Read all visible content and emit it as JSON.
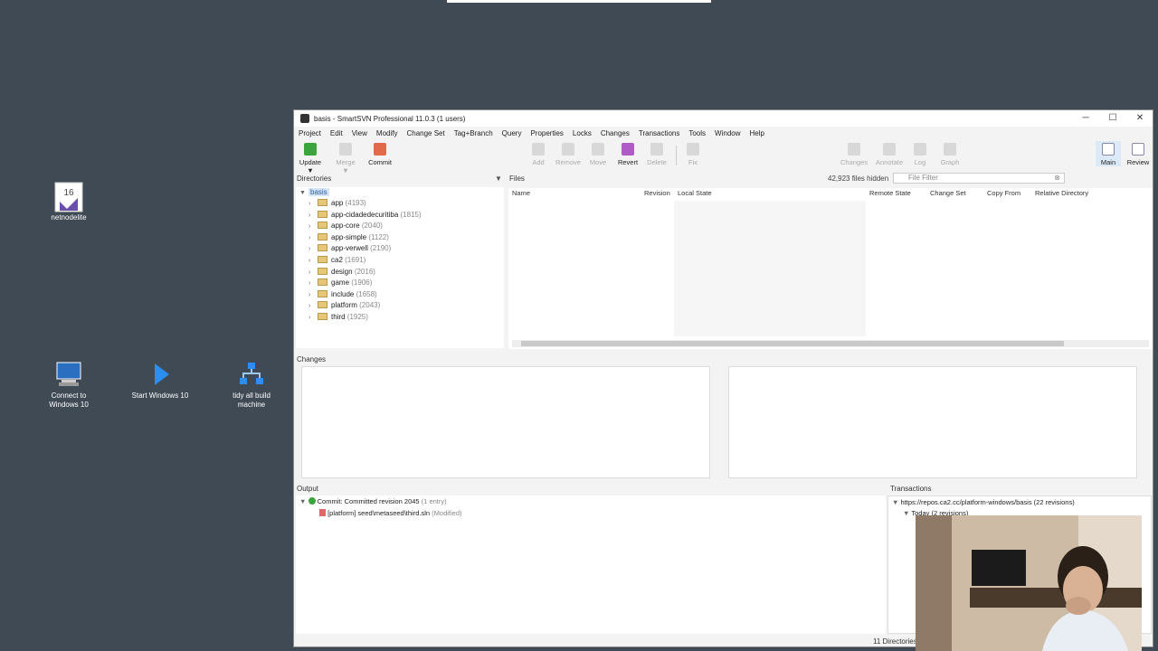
{
  "desktop": {
    "icons": [
      {
        "label": "netnodelite",
        "icon": "visual-studio-icon"
      },
      {
        "label": "Connect to Windows 10",
        "icon": "remote-desktop-icon"
      },
      {
        "label": "Start Windows 10",
        "icon": "play-icon"
      },
      {
        "label": "tidy all build machine",
        "icon": "network-icon"
      }
    ]
  },
  "window": {
    "title": "basis - SmartSVN Professional 11.0.3 (1 users)",
    "controls": {
      "minimize": "─",
      "maximize": "☐",
      "close": "✕"
    }
  },
  "menu": [
    "Project",
    "Edit",
    "View",
    "Modify",
    "Change Set",
    "Tag+Branch",
    "Query",
    "Properties",
    "Locks",
    "Changes",
    "Transactions",
    "Tools",
    "Window",
    "Help"
  ],
  "toolbar": {
    "update": "Update ▼",
    "merge": "Merge ▼",
    "commit": "Commit",
    "add": "Add",
    "remove": "Remove",
    "move": "Move",
    "revert": "Revert",
    "delete": "Delete",
    "fix": "Fix",
    "changes": "Changes",
    "annotate": "Annotate",
    "log": "Log",
    "graph": "Graph",
    "main": "Main",
    "review": "Review"
  },
  "directories": {
    "header": "Directories",
    "root": "basis",
    "items": [
      {
        "name": "app",
        "count": "(4193)"
      },
      {
        "name": "app-cidadedecuritiba",
        "count": "(1815)"
      },
      {
        "name": "app-core",
        "count": "(2040)"
      },
      {
        "name": "app-simple",
        "count": "(1122)"
      },
      {
        "name": "app-verwell",
        "count": "(2190)"
      },
      {
        "name": "ca2",
        "count": "(1691)"
      },
      {
        "name": "design",
        "count": "(2016)"
      },
      {
        "name": "game",
        "count": "(1906)"
      },
      {
        "name": "include",
        "count": "(1658)"
      },
      {
        "name": "platform",
        "count": "(2043)"
      },
      {
        "name": "third",
        "count": "(1925)"
      }
    ]
  },
  "files": {
    "header": "Files",
    "hidden": "42,923 files hidden",
    "filter_placeholder": "File Filter",
    "columns": [
      "Name",
      "Revision",
      "Local State",
      "Remote State",
      "Change Set",
      "Copy From",
      "Relative Directory"
    ]
  },
  "changes": {
    "header": "Changes"
  },
  "output": {
    "header": "Output",
    "entry": "Commit: Committed revision 2045",
    "entry_meta": "(1 entry)",
    "file": "[platform] seed\\metaseed\\third.sln",
    "file_state": "(Modified)"
  },
  "transactions": {
    "header": "Transactions",
    "url": "https://repos.ca2.cc/platform-windows/basis (22 revisions)",
    "today": "Today (2 revisions)"
  },
  "status": {
    "directories": "11 Directories"
  },
  "colors": {
    "desktop": "#3f4a54",
    "accent_green": "#3aa53a",
    "selected": "#3d7bd9"
  }
}
